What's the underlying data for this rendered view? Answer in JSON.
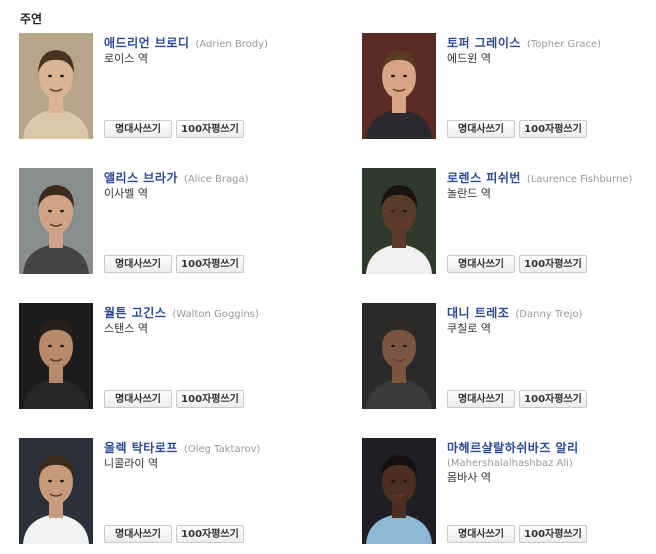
{
  "section": {
    "title": "주연"
  },
  "buttons": {
    "quote": "명대사쓰기",
    "review": "100자평쓰기"
  },
  "cast": [
    {
      "name_ko": "애드리언 브로디",
      "name_en": "(Adrien Brody)",
      "role": "로이스 역",
      "bg": "#b7a58a",
      "skin": "#d8b394",
      "hair": "#4a3220",
      "shirt": "#d9c9a8"
    },
    {
      "name_ko": "토퍼 그레이스",
      "name_en": "(Topher Grace)",
      "role": "에드윈 역",
      "bg": "#5a2a24",
      "skin": "#d7a585",
      "hair": "#5a3a22",
      "shirt": "#2a2a2e"
    },
    {
      "name_ko": "앨리스 브라가",
      "name_en": "(Alice Braga)",
      "role": "이사벨 역",
      "bg": "#8a8f8e",
      "skin": "#d0a387",
      "hair": "#3a2a1c",
      "shirt": "#444444"
    },
    {
      "name_ko": "로렌스 피쉬번",
      "name_en": "(Laurence Fishburne)",
      "role": "놀란드 역",
      "bg": "#2f3a2c",
      "skin": "#5a3a28",
      "hair": "#1a1410",
      "shirt": "#f0f0f0"
    },
    {
      "name_ko": "월튼 고긴스",
      "name_en": "(Walton Goggins)",
      "role": "스탠스 역",
      "bg": "#1c1c1c",
      "skin": "#b88a6c",
      "hair": "#2a2018",
      "shirt": "#262626"
    },
    {
      "name_ko": "대니 트레조",
      "name_en": "(Danny Trejo)",
      "role": "쿠칠로 역",
      "bg": "#2a2a2a",
      "skin": "#7a5640",
      "hair": "#2e2a26",
      "shirt": "#3a3a3a"
    },
    {
      "name_ko": "올렉 탁타로프",
      "name_en": "(Oleg Taktarov)",
      "role": "니콜라이 역",
      "bg": "#2a2f3a",
      "skin": "#c79a7c",
      "hair": "#3a2a1c",
      "shirt": "#f2f2f2"
    },
    {
      "name_ko": "마헤르샬랄하쉬바즈 알리",
      "name_en": "(Mahershalalhashbaz Ali)",
      "role": "몸바사 역",
      "bg": "#1e1e24",
      "skin": "#4a2f22",
      "hair": "#141010",
      "shirt": "#8fb7d6"
    }
  ]
}
